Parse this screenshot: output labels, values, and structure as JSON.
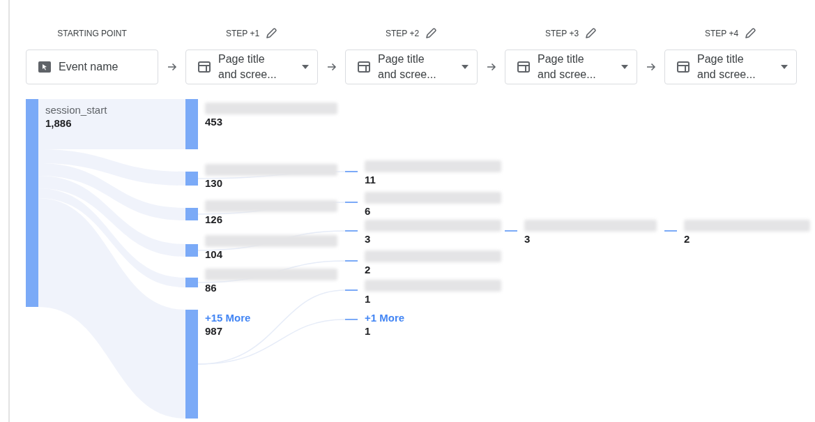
{
  "steps": [
    {
      "title": "STARTING POINT",
      "editable": false,
      "selector": {
        "kind": "event",
        "label": "Event name",
        "has_menu": false
      }
    },
    {
      "title": "STEP +1",
      "editable": true,
      "selector": {
        "kind": "page",
        "label": "Page title and scree...",
        "has_menu": true
      }
    },
    {
      "title": "STEP +2",
      "editable": true,
      "selector": {
        "kind": "page",
        "label": "Page title and scree...",
        "has_menu": true
      }
    },
    {
      "title": "STEP +3",
      "editable": true,
      "selector": {
        "kind": "page",
        "label": "Page title and scree...",
        "has_menu": true
      }
    },
    {
      "title": "STEP +4",
      "editable": true,
      "selector": {
        "kind": "page",
        "label": "Page title and scree...",
        "has_menu": true
      }
    }
  ],
  "columns": [
    {
      "nodes": [
        {
          "kind": "node",
          "label": "session_start",
          "value": "1,886"
        }
      ]
    },
    {
      "nodes": [
        {
          "kind": "blurred",
          "value": "453"
        },
        {
          "kind": "blurred",
          "value": "130"
        },
        {
          "kind": "blurred",
          "value": "126"
        },
        {
          "kind": "blurred",
          "value": "104"
        },
        {
          "kind": "blurred",
          "value": "86"
        },
        {
          "kind": "more",
          "label": "+15 More",
          "value": "987"
        }
      ]
    },
    {
      "nodes": [
        {
          "kind": "blurred",
          "value": "11"
        },
        {
          "kind": "blurred",
          "value": "6"
        },
        {
          "kind": "blurred",
          "value": "3"
        },
        {
          "kind": "blurred",
          "value": "2"
        },
        {
          "kind": "blurred",
          "value": "1"
        },
        {
          "kind": "more",
          "label": "+1 More",
          "value": "1"
        }
      ]
    },
    {
      "nodes": [
        {
          "kind": "blurred",
          "value": "3"
        }
      ]
    },
    {
      "nodes": [
        {
          "kind": "blurred",
          "value": "2"
        }
      ]
    }
  ]
}
